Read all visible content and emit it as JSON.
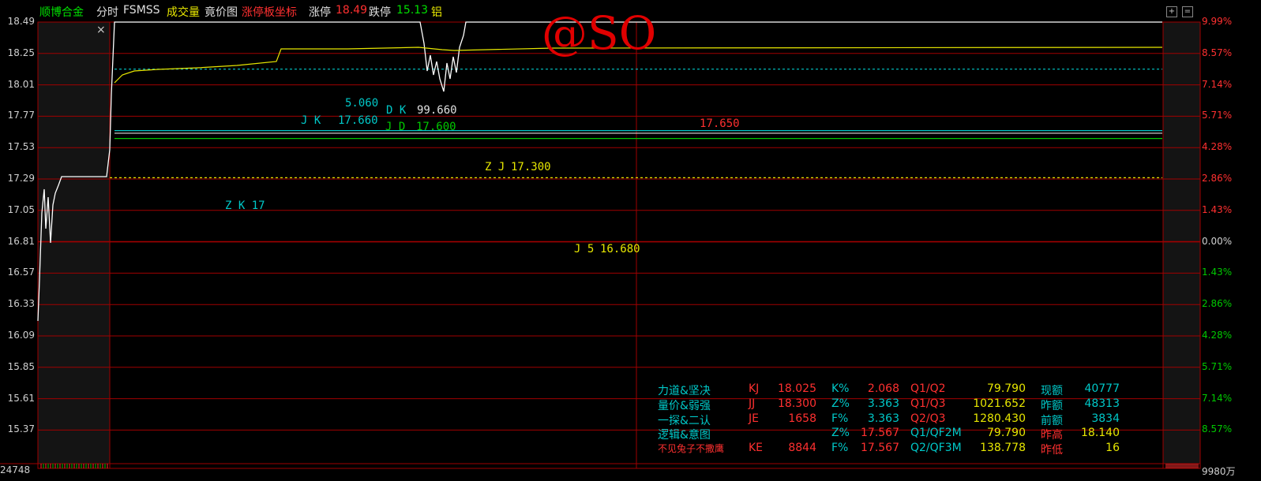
{
  "colors": {
    "grid": "#a00000",
    "price_line": "#ffffff",
    "avg_line": "#e6e600",
    "cyan": "#00c8c8",
    "yellow": "#e6e600",
    "red": "#ff3030",
    "green": "#00c800",
    "white": "#e0e0e0"
  },
  "header": {
    "stock_name": "顺博合金",
    "mode": "分时",
    "indicator": "FSMSS",
    "volume_label": "成交量",
    "auction_label": "竟价图",
    "limit_board_label": "涨停板坐标",
    "limit_up_label": "涨停",
    "limit_up_value": "18.49",
    "limit_down_label": "跌停",
    "limit_down_value": "15.13",
    "sector": "铝"
  },
  "watermark": "@SO",
  "close_glyph": "×",
  "window_buttons": {
    "maximize": "+",
    "restore": "="
  },
  "y_axis_prices": [
    "18.49",
    "18.25",
    "18.01",
    "17.77",
    "17.53",
    "17.29",
    "17.05",
    "16.81",
    "16.57",
    "16.33",
    "16.09",
    "15.85",
    "15.61",
    "15.37"
  ],
  "y_axis_pcts": [
    "9.99%",
    "8.57%",
    "7.14%",
    "5.71%",
    "4.28%",
    "2.86%",
    "1.43%",
    "0.00%",
    "1.43%",
    "2.86%",
    "4.28%",
    "5.71%",
    "7.14%",
    "8.57%"
  ],
  "volume_left": "24748",
  "volume_right": "9980万",
  "annotations": {
    "num_5060": "5.060",
    "dk_label": "D K",
    "dk_value": "99.660",
    "jk_label": "J K",
    "jk_value": "17.660",
    "jd_label": "J D",
    "jd_value": "17.600",
    "line_17650": "17.650",
    "zj_label": "Z J",
    "zj_value": "17.300",
    "zk_label": "Z K 17",
    "j5_label": "J 5",
    "j5_value": "16.680"
  },
  "panel": {
    "rows": [
      {
        "name": "力道&坚决",
        "code": "KJ",
        "code_val": "18.025",
        "m": "K%",
        "m_val": "2.068",
        "q": "Q1/Q2",
        "q_val": "79.790",
        "k": "现额",
        "k_val": "40777"
      },
      {
        "name": "量价&弱强",
        "code": "JJ",
        "code_val": "18.300",
        "m": "Z%",
        "m_val": "3.363",
        "q": "Q1/Q3",
        "q_val": "1021.652",
        "k": "昨额",
        "k_val": "48313"
      },
      {
        "name": "一探&二认",
        "code": "JE",
        "code_val": "1658",
        "m": "F%",
        "m_val": "3.363",
        "q": "Q2/Q3",
        "q_val": "1280.430",
        "k": "前额",
        "k_val": "3834"
      },
      {
        "name": "逻辑&意图",
        "code": "",
        "code_val": "",
        "m": "Z%",
        "m_val": "17.567",
        "q": "Q1/QF2M",
        "q_val": "79.790",
        "k": "昨高",
        "k_val": "18.140"
      },
      {
        "name": "不见兔子不撒鹰",
        "code": "KE",
        "code_val": "8844",
        "m": "F%",
        "m_val": "17.567",
        "q": "Q2/QF3M",
        "q_val": "138.778",
        "k": "昨低",
        "k_val": "16"
      }
    ]
  }
}
